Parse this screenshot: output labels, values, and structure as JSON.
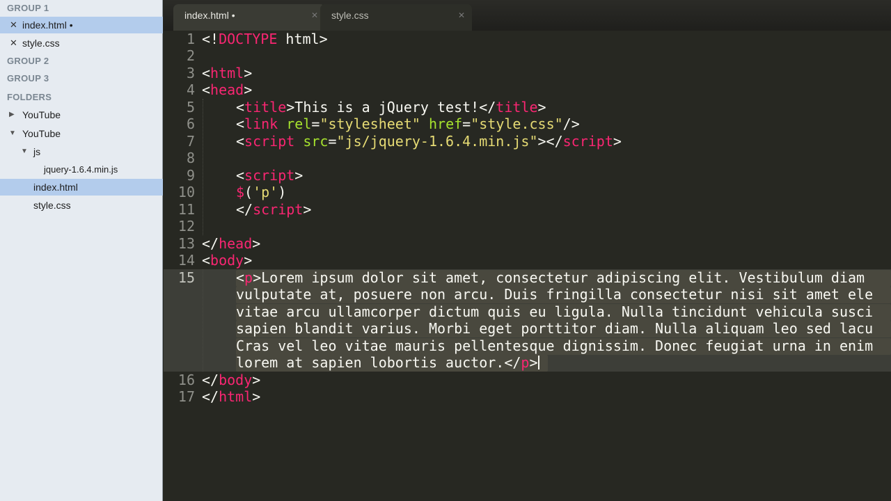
{
  "sidebar": {
    "group1": "GROUP 1",
    "open_files": [
      {
        "label": "index.html •",
        "selected": true
      },
      {
        "label": "style.css",
        "selected": false
      }
    ],
    "group2": "GROUP 2",
    "group3": "GROUP 3",
    "folders_heading": "FOLDERS",
    "tree": [
      {
        "label": "YouTube",
        "expanded": false
      },
      {
        "label": "YouTube",
        "expanded": true
      },
      {
        "label": "js",
        "expanded": true
      },
      {
        "label": "jquery-1.6.4.min.js"
      },
      {
        "label": "index.html",
        "selected": true
      },
      {
        "label": "style.css"
      }
    ]
  },
  "tabs": [
    {
      "label": "index.html •",
      "active": true,
      "close": "✕"
    },
    {
      "label": "style.css",
      "active": false,
      "close": "✕"
    }
  ],
  "editor": {
    "line_numbers": [
      "1",
      "2",
      "3",
      "4",
      "5",
      "6",
      "7",
      "8",
      "9",
      "10",
      "11",
      "12",
      "13",
      "14",
      "15",
      "16",
      "17"
    ],
    "lines": {
      "l1": {
        "a": "<!",
        "b": "DOCTYPE",
        "c": " html>"
      },
      "l3": {
        "a": "<",
        "b": "html",
        "c": ">"
      },
      "l4": {
        "a": "<",
        "b": "head",
        "c": ">"
      },
      "l5": {
        "a": "<",
        "b": "title",
        "c": ">This is a jQuery test!</",
        "d": "title",
        "e": ">"
      },
      "l6": {
        "a": "<",
        "b": "link",
        "c": " ",
        "d": "rel",
        "e": "=",
        "f": "\"stylesheet\"",
        "g": " ",
        "h": "href",
        "i": "=",
        "j": "\"style.css\"",
        "k": "/>"
      },
      "l7": {
        "a": "<",
        "b": "script",
        "c": " ",
        "d": "src",
        "e": "=",
        "f": "\"js/jquery-1.6.4.min.js\"",
        "g": "></",
        "h": "script",
        "i": ">"
      },
      "l9": {
        "a": "<",
        "b": "script",
        "c": ">"
      },
      "l10": {
        "a": "$",
        "b": "(",
        "c": "'p'",
        "d": ")"
      },
      "l11": {
        "a": "</",
        "b": "script",
        "c": ">"
      },
      "l13": {
        "a": "</",
        "b": "head",
        "c": ">"
      },
      "l14": {
        "a": "<",
        "b": "body",
        "c": ">"
      },
      "l15": {
        "open_a": "<",
        "open_b": "p",
        "open_c": ">",
        "w1": "Lorem ipsum dolor sit amet, consectetur adipiscing elit. Vestibulum diam",
        "w2": "vulputate at, posuere non arcu. Duis fringilla consectetur nisi sit amet ele",
        "w3": "vitae arcu ullamcorper dictum quis eu ligula. Nulla tincidunt vehicula susci",
        "w4": "sapien blandit varius. Morbi eget porttitor diam. Nulla aliquam leo sed lacu",
        "w5": "Cras vel leo vitae mauris pellentesque dignissim. Donec feugiat urna in enim",
        "w6": "lorem at sapien lobortis auctor.",
        "close_a": "</",
        "close_b": "p",
        "close_c": ">"
      },
      "l16": {
        "a": "</",
        "b": "body",
        "c": ">"
      },
      "l17": {
        "a": "</",
        "b": "html",
        "c": ">"
      }
    }
  },
  "colors": {
    "editor_bg": "#272822",
    "tag": "#f92672",
    "attribute": "#a6e22e",
    "string": "#e6db74",
    "text": "#f8f8f2",
    "sidebar_bg": "#e6ebf1",
    "sidebar_selection": "#b3ccec"
  }
}
